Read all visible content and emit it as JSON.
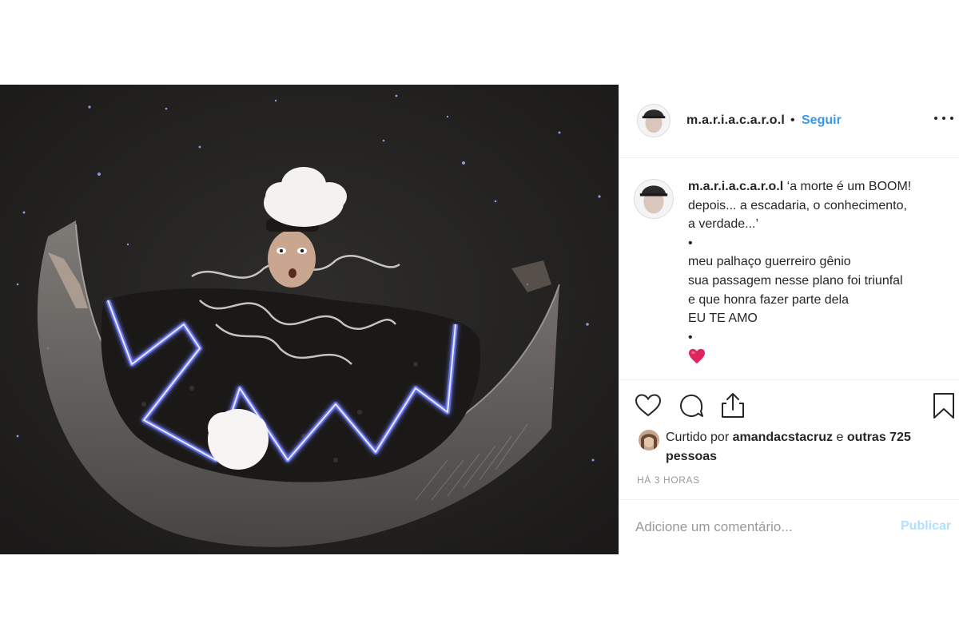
{
  "post": {
    "photo_name": "clown-on-crescent-moon",
    "header": {
      "username": "m.a.r.i.a.c.a.r.o.l",
      "separator": "•",
      "follow_label": "Seguir",
      "more_icon": "more-options-icon"
    },
    "caption": {
      "username": "m.a.r.i.a.c.a.r.o.l",
      "lines": [
        "‘a morte é um BOOM!",
        "depois... a escadaria, o conhecimento,",
        "a verdade...’",
        "•",
        "meu palhaço guerreiro gênio",
        "sua passagem nesse plano foi triunfal",
        "e que honra fazer parte dela",
        "EU TE AMO",
        "•"
      ],
      "emoji": "red-heart-icon"
    },
    "actions": {
      "icons": [
        "heart-icon",
        "comment-icon",
        "share-icon",
        "bookmark-icon"
      ]
    },
    "likes": {
      "prefix": "Curtido por",
      "liker": "amandacstacruz",
      "conjunction": "e",
      "others": "outras 725 pessoas"
    },
    "timestamp": "HÁ 3 HORAS",
    "comment_box": {
      "placeholder": "Adicione um comentário...",
      "publish_label": "Publicar"
    },
    "colors": {
      "link_blue": "#3897f0",
      "publish_disabled": "#b2dffc",
      "text": "#262626",
      "muted": "#999999",
      "divider": "#efefef",
      "heart_red": "#e0245e"
    }
  }
}
